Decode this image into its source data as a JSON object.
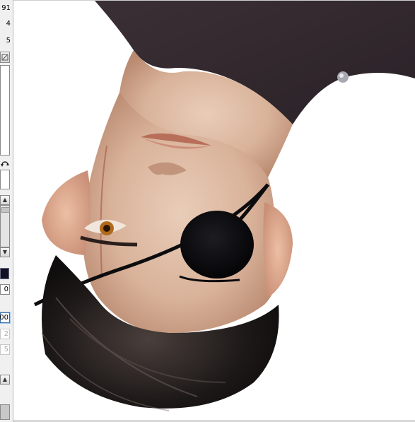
{
  "left_panel": {
    "values": [
      "91",
      "4",
      "5"
    ],
    "field_values": [
      "0",
      "00",
      "2",
      "5"
    ],
    "icons": [
      "reset-icon",
      "rotate-icon",
      "scroll-up-icon",
      "scroll-down-icon",
      "color-swatch-icon"
    ],
    "swatch_color": "#101020"
  },
  "canvas": {
    "subject": "upside-down digital painting of a man wearing an eye patch",
    "background": "#ffffff"
  }
}
